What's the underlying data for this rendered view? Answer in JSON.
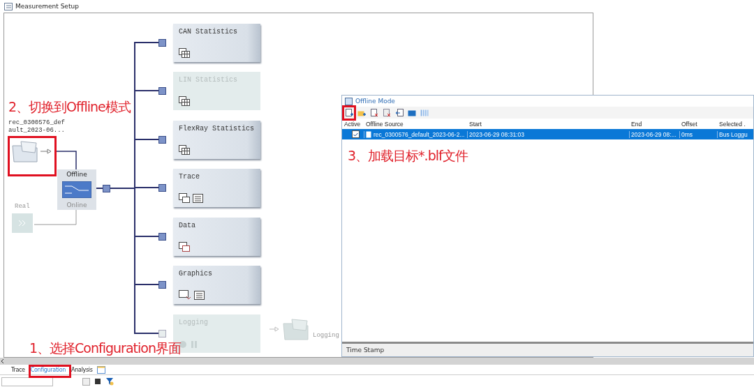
{
  "window": {
    "title": "Measurement Setup"
  },
  "source": {
    "lines": [
      "rec_0300576_def",
      "ault_2023-06..."
    ]
  },
  "switch": {
    "options": [
      {
        "label": "Offline",
        "selected": true
      },
      {
        "label": "Online",
        "selected": false
      }
    ]
  },
  "real": {
    "label": "Real"
  },
  "blocks": [
    {
      "title": "CAN Statistics",
      "disabled": false,
      "kind": "statistics"
    },
    {
      "title": "LIN Statistics",
      "disabled": true,
      "kind": "statistics"
    },
    {
      "title": "FlexRay Statistics",
      "disabled": false,
      "kind": "statistics"
    },
    {
      "title": "Trace",
      "disabled": false,
      "kind": "trace"
    },
    {
      "title": "Data",
      "disabled": false,
      "kind": "data"
    },
    {
      "title": "Graphics",
      "disabled": false,
      "kind": "graphics"
    },
    {
      "title": "Logging",
      "disabled": true,
      "kind": "logging"
    }
  ],
  "logging_output": {
    "label": "Logging"
  },
  "offline_mode": {
    "title": "Offline Mode",
    "active_header": "Active",
    "columns": [
      "Offline Source",
      "Start",
      "End",
      "Offset",
      "Selected ."
    ],
    "rows": [
      {
        "checked": true,
        "selected": true,
        "cells": [
          "rec_0300576_default_2023-06-2...",
          "2023-06-29 08:31:03",
          "2023-06-29 08:...",
          "0ms",
          "Bus Loggu"
        ]
      }
    ],
    "footer": "Time Stamp"
  },
  "tabs": [
    {
      "label": "Trace",
      "selected": false
    },
    {
      "label": "Configuration",
      "selected": true
    },
    {
      "label": "Analysis",
      "selected": false
    }
  ],
  "annotations": [
    {
      "text": "2、切换到Offline模式"
    },
    {
      "text": "3、加载目标*.blf文件"
    },
    {
      "text": "1、选择Configuration界面"
    }
  ]
}
